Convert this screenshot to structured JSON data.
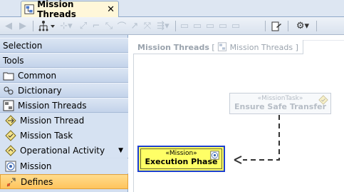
{
  "tab": {
    "title": "Mission Threads",
    "close": "✕"
  },
  "toolbar": {
    "items": [
      "back",
      "forward",
      "layout",
      "insert",
      "line",
      "line",
      "line",
      "line",
      "line",
      "line",
      "line",
      "align",
      "align",
      "align",
      "align",
      "align",
      "export",
      "settings"
    ]
  },
  "palette": {
    "sections": {
      "selection": "Selection",
      "tools": "Tools",
      "common": "Common",
      "dictionary": "Dictionary",
      "mission_threads": "Mission Threads"
    },
    "items": [
      {
        "label": "Mission Thread",
        "icon": "mission-thread-icon"
      },
      {
        "label": "Mission Task",
        "icon": "mission-task-icon"
      },
      {
        "label": "Operational Activity",
        "icon": "operational-activity-icon",
        "has_dropdown": true
      },
      {
        "label": "Mission",
        "icon": "mission-icon"
      },
      {
        "label": "Defines",
        "icon": "defines-icon",
        "selected": true
      }
    ]
  },
  "diagram": {
    "frame_name": "Mission Threads",
    "frame_open_bracket": "[",
    "frame_type": "Mission Threads",
    "frame_close_bracket": "]",
    "task_node": {
      "stereotype": "«MissionTask»",
      "name": "Ensure Safe Transfer"
    },
    "mission_node": {
      "stereotype": "«Mission»",
      "name": "Execution Phase"
    }
  },
  "colors": {
    "selection_highlight": "#ffc45d",
    "mission_fill": "#ffff66",
    "mission_border": "#1d3fd0",
    "palette_bg": "#d3dff0"
  }
}
